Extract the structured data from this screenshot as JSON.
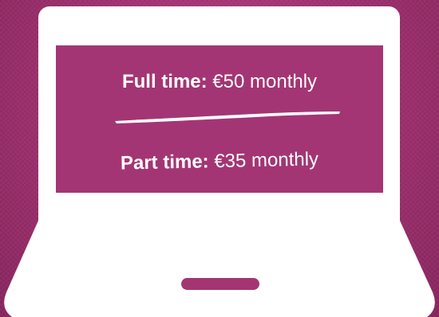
{
  "pricing": {
    "full_time": {
      "label": "Full time:",
      "price": "€50 monthly"
    },
    "part_time": {
      "label": "Part time:",
      "price": "€35 monthly"
    }
  },
  "colors": {
    "background": "#a0326f",
    "screen": "#a43574",
    "frame": "#ffffff",
    "text": "#ffffff"
  }
}
